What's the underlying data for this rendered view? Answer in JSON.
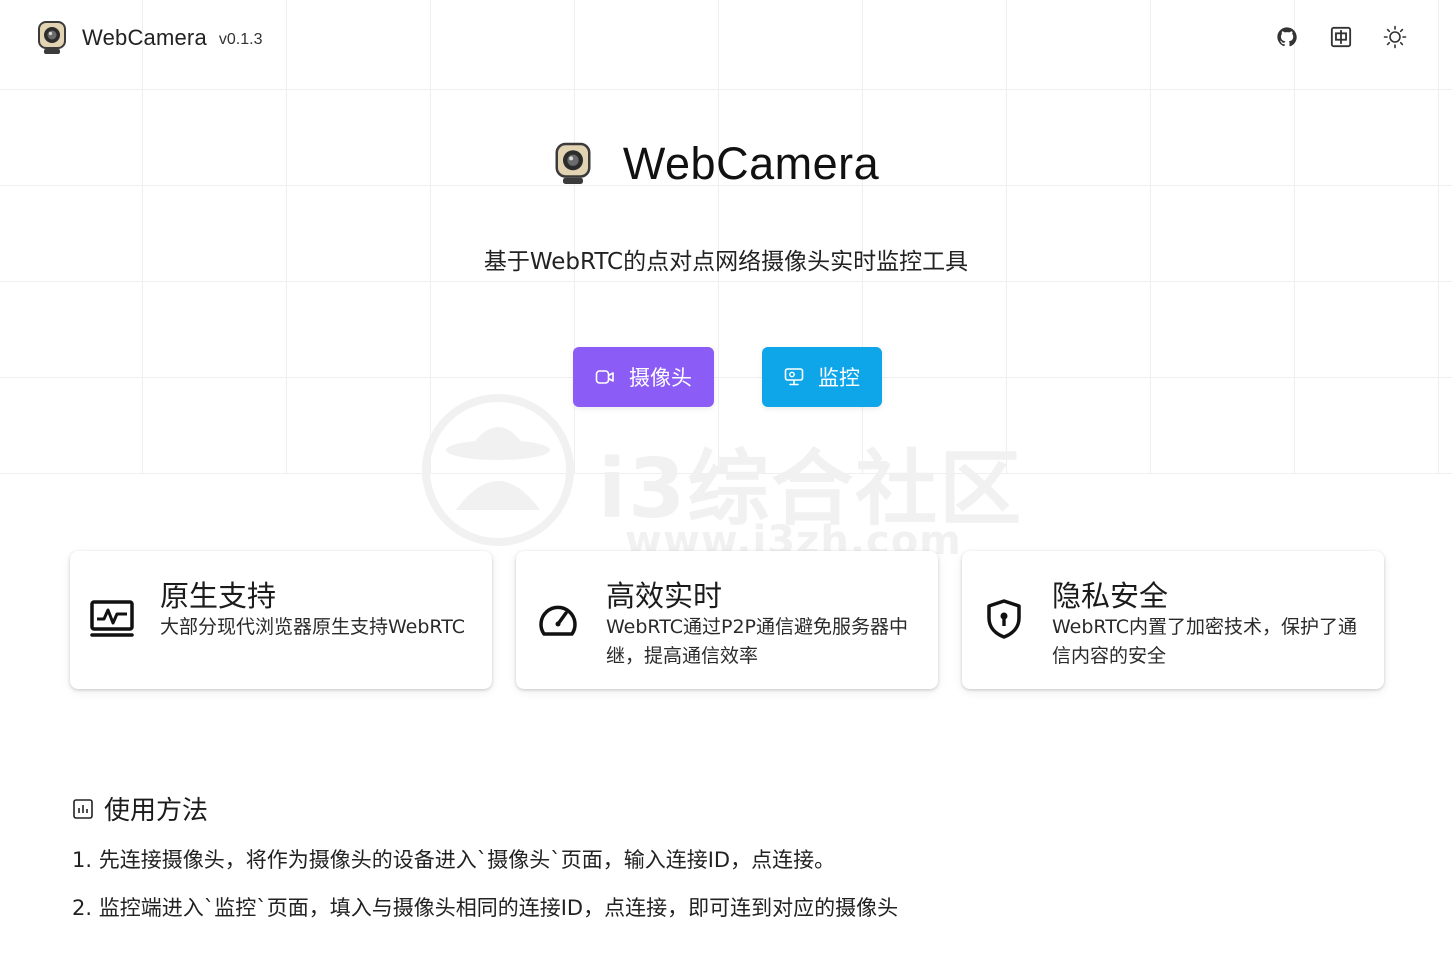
{
  "header": {
    "app_name": "WebCamera",
    "version": "v0.1.3",
    "icons": [
      "github-icon",
      "language-icon",
      "theme-toggle-icon"
    ]
  },
  "hero": {
    "title": "WebCamera",
    "subtitle": "基于WebRTC的点对点网络摄像头实时监控工具",
    "camera_button_label": "摄像头",
    "monitor_button_label": "监控"
  },
  "watermark": {
    "text": "i3综合社区",
    "url": "www.i3zh.com"
  },
  "features": [
    {
      "icon": "monitor-chart-icon",
      "title": "原生支持",
      "desc": "大部分现代浏览器原生支持WebRTC"
    },
    {
      "icon": "speedometer-icon",
      "title": "高效实时",
      "desc": "WebRTC通过P2P通信避免服务器中继，提高通信效率"
    },
    {
      "icon": "shield-lock-icon",
      "title": "隐私安全",
      "desc": "WebRTC内置了加密技术，保护了通信内容的安全"
    }
  ],
  "usage": {
    "title": "使用方法",
    "steps": [
      "1. 先连接摄像头，将作为摄像头的设备进入`摄像头`页面，输入连接ID，点连接。",
      "2. 监控端进入`监控`页面，填入与摄像头相同的连接ID，点连接，即可连到对应的摄像头"
    ]
  },
  "colors": {
    "camera_button": "#8b5cf6",
    "monitor_button": "#0ea5e9"
  }
}
